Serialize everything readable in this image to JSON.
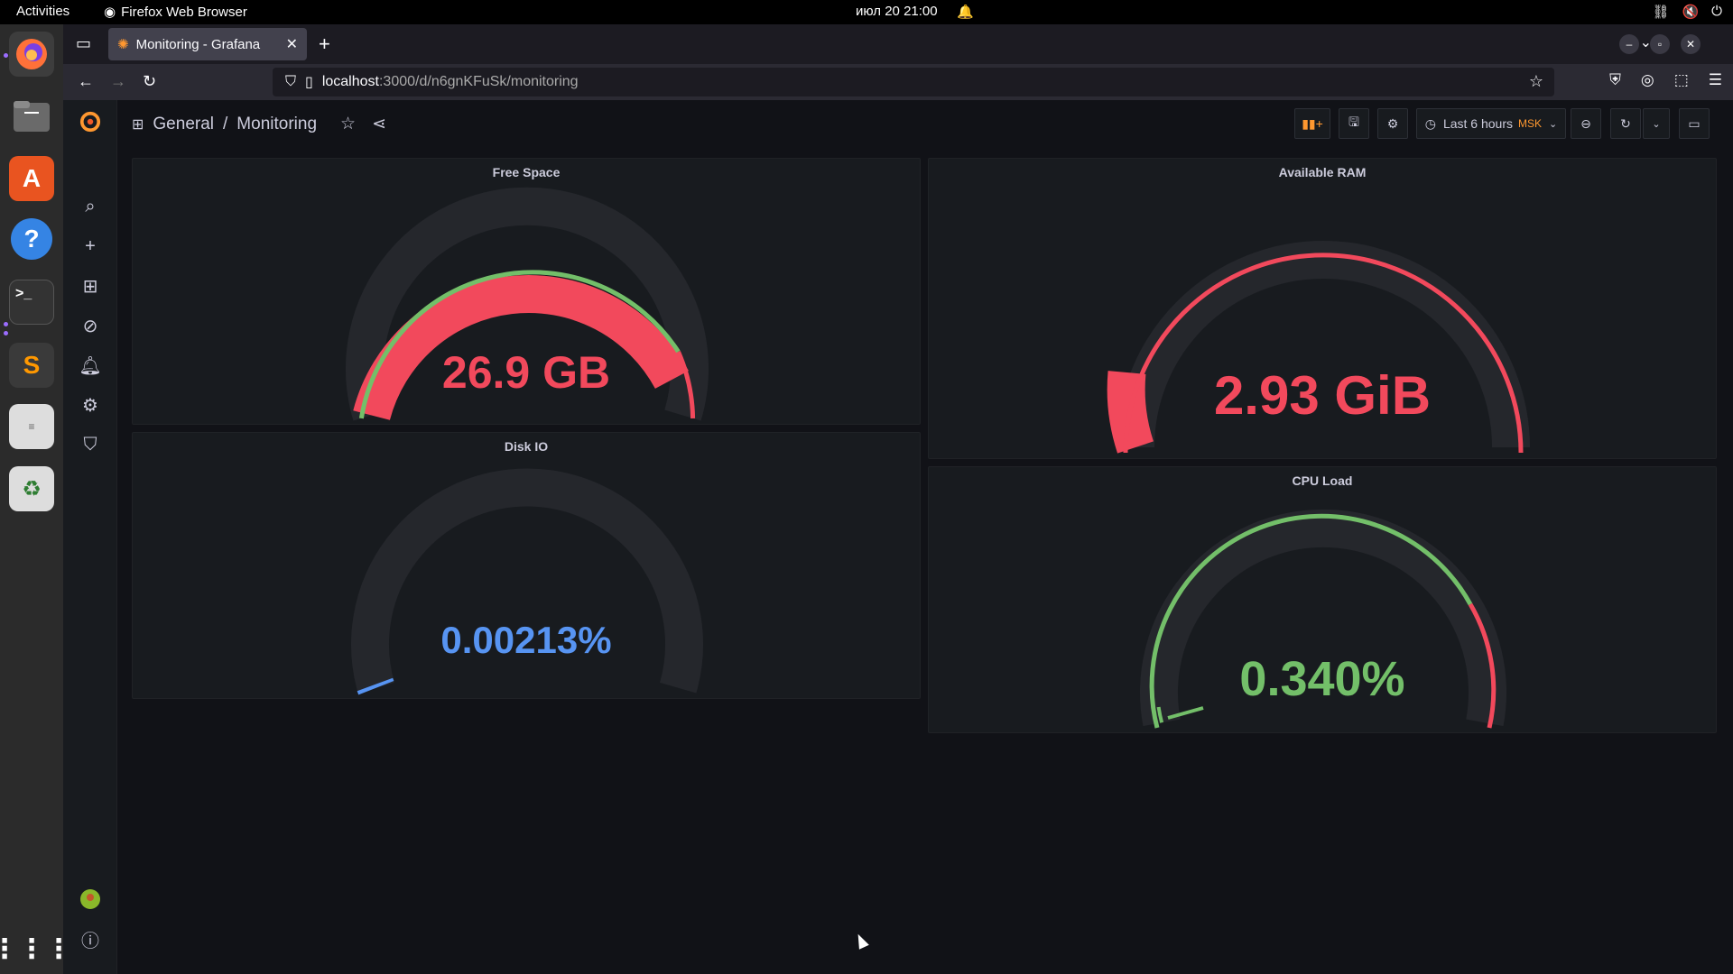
{
  "system": {
    "activities": "Activities",
    "app_name": "Firefox Web Browser",
    "clock": "июл 20  21:00"
  },
  "browser": {
    "tab_title": "Monitoring - Grafana",
    "url_host": "localhost",
    "url_path": ":3000/d/n6gnKFuSk/monitoring"
  },
  "grafana": {
    "breadcrumb": {
      "folder": "General",
      "sep": "/",
      "dashboard": "Monitoring"
    },
    "time_range": "Last 6 hours",
    "timezone": "MSK",
    "panels": {
      "free_space": {
        "title": "Free Space",
        "value": "26.9 GB",
        "color": "#f2495c",
        "fill_fraction": 0.92
      },
      "available_ram": {
        "title": "Available RAM",
        "value": "2.93 GiB",
        "color": "#f2495c",
        "fill_fraction": 0.1
      },
      "disk_io": {
        "title": "Disk IO",
        "value": "0.00213%",
        "color": "#5794f2",
        "fill_fraction": 0.02
      },
      "cpu_load": {
        "title": "CPU Load",
        "value": "0.340%",
        "color": "#73bf69",
        "fill_fraction": 0.05
      }
    },
    "colors": {
      "green": "#73bf69",
      "red": "#f2495c",
      "blue": "#5794f2",
      "track": "#25272c"
    }
  }
}
